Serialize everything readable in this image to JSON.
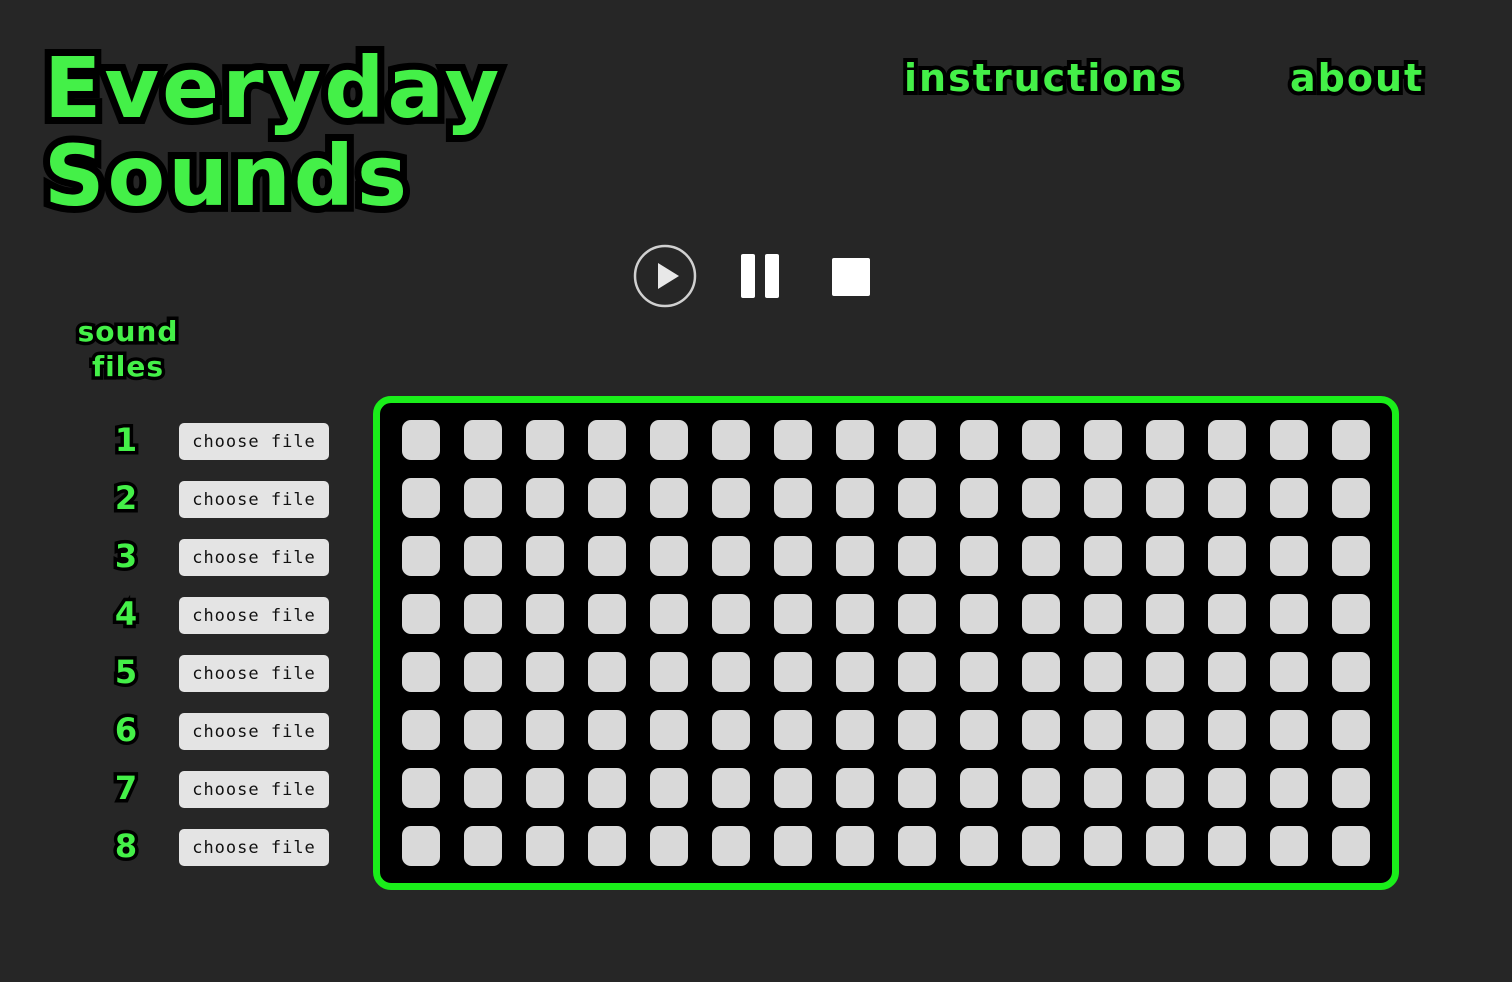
{
  "header": {
    "title_line1": "Everyday",
    "title_line2": "Sounds",
    "nav": {
      "instructions": "instructions",
      "about": "about"
    }
  },
  "transport": {
    "play_icon": "play-icon",
    "pause_icon": "pause-icon",
    "stop_icon": "stop-icon"
  },
  "sound_files": {
    "heading_line1": "sound",
    "heading_line2": "files",
    "tracks": [
      {
        "number": "1",
        "button_label": "choose file"
      },
      {
        "number": "2",
        "button_label": "choose file"
      },
      {
        "number": "3",
        "button_label": "choose file"
      },
      {
        "number": "4",
        "button_label": "choose file"
      },
      {
        "number": "5",
        "button_label": "choose file"
      },
      {
        "number": "6",
        "button_label": "choose file"
      },
      {
        "number": "7",
        "button_label": "choose file"
      },
      {
        "number": "8",
        "button_label": "choose file"
      }
    ]
  },
  "sequencer": {
    "rows": 8,
    "steps": 16,
    "active_steps": []
  },
  "colors": {
    "background": "#262626",
    "accent_green": "#44f048",
    "grid_border": "#1aee1a",
    "pad_off": "#d9d9d9",
    "grid_background": "#000000"
  }
}
